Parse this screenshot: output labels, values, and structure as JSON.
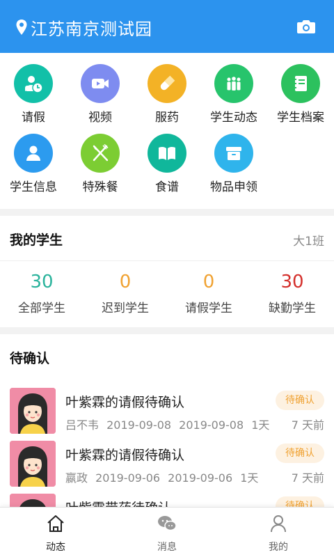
{
  "header": {
    "title": "江苏南京测试园",
    "location_icon": "location-pin-icon",
    "camera_icon": "camera-icon"
  },
  "features": [
    {
      "label": "请假",
      "icon": "person-clock-icon",
      "color": "#12c0a8"
    },
    {
      "label": "视频",
      "icon": "video-camera-icon",
      "color": "#7e8cf0"
    },
    {
      "label": "服药",
      "icon": "pill-icon",
      "color": "#f3b226"
    },
    {
      "label": "学生动态",
      "icon": "group-icon",
      "color": "#27c46c"
    },
    {
      "label": "学生档案",
      "icon": "notebook-icon",
      "color": "#2cc15e"
    },
    {
      "label": "学生信息",
      "icon": "person-icon",
      "color": "#2c9bef"
    },
    {
      "label": "特殊餐",
      "icon": "fork-knife-icon",
      "color": "#7ccd33"
    },
    {
      "label": "食谱",
      "icon": "book-icon",
      "color": "#10b79b"
    },
    {
      "label": "物品申领",
      "icon": "box-icon",
      "color": "#2fb4ec"
    }
  ],
  "my_students": {
    "title": "我的学生",
    "class_name": "大1班",
    "stats": [
      {
        "value": "30",
        "label": "全部学生",
        "color": "#2bb39c"
      },
      {
        "value": "0",
        "label": "迟到学生",
        "color": "#f0a232"
      },
      {
        "value": "0",
        "label": "请假学生",
        "color": "#f0a232"
      },
      {
        "value": "30",
        "label": "缺勤学生",
        "color": "#d4302c"
      }
    ]
  },
  "pending": {
    "title": "待确认",
    "items": [
      {
        "title": "叶紫霖的请假待确认",
        "meta": "吕不韦 2019-09-08 2019-09-08 1天",
        "badge": "待确认",
        "ago": "7 天前"
      },
      {
        "title": "叶紫霖的请假待确认",
        "meta": "嬴政 2019-09-06 2019-09-06 1天",
        "badge": "待确认",
        "ago": "7 天前"
      },
      {
        "title": "叶紫霖带药待确认",
        "meta": "",
        "badge": "待确认",
        "ago": ""
      }
    ]
  },
  "tabs": [
    {
      "label": "动态",
      "icon": "home-icon",
      "active": true
    },
    {
      "label": "消息",
      "icon": "chat-icon",
      "active": false
    },
    {
      "label": "我的",
      "icon": "user-icon",
      "active": false
    }
  ]
}
